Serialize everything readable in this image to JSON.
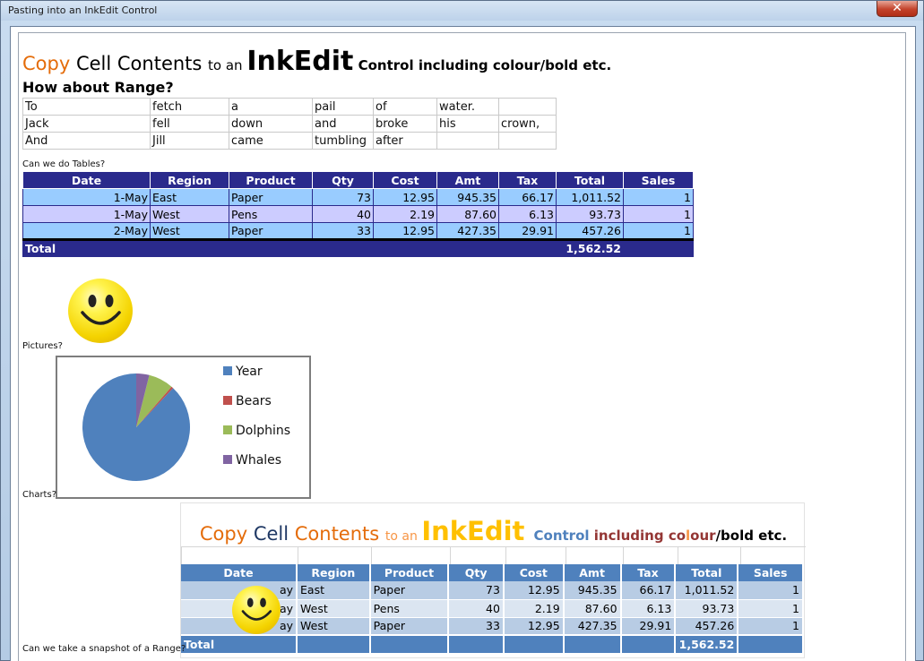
{
  "window": {
    "title": "Pasting into an InkEdit Control",
    "close_label": "✕"
  },
  "heading": {
    "copy": "Copy",
    "cell_contents": " Cell Contents ",
    "to_an": "to an ",
    "inkedit": "InkEdit",
    "rest": " Control including colour/bold etc."
  },
  "subheading": "How about Range?",
  "words_grid": [
    [
      "To",
      "fetch",
      "a",
      "pail",
      "of",
      "water.",
      ""
    ],
    [
      "Jack",
      "fell",
      "down",
      "and",
      "broke",
      "his",
      "crown,"
    ],
    [
      "And",
      "Jill",
      "came",
      "tumbling",
      "after",
      "",
      ""
    ]
  ],
  "labels": {
    "tables": "Can we do Tables?",
    "pictures": "Pictures?",
    "charts": "Charts?",
    "snapshot": "Can we take a snapshot of a Range?"
  },
  "data_table": {
    "headers": [
      "Date",
      "Region",
      "Product",
      "Qty",
      "Cost",
      "Amt",
      "Tax",
      "Total",
      "Sales"
    ],
    "rows": [
      [
        "1-May",
        "East",
        "Paper",
        "73",
        "12.95",
        "945.35",
        "66.17",
        "1,011.52",
        "1"
      ],
      [
        "1-May",
        "West",
        "Pens",
        "40",
        "2.19",
        "87.60",
        "6.13",
        "93.73",
        "1"
      ],
      [
        "2-May",
        "West",
        "Paper",
        "33",
        "12.95",
        "427.35",
        "29.91",
        "457.26",
        "1"
      ]
    ],
    "total_label": "Total",
    "total_value": "1,562.52"
  },
  "pie_chart": {
    "legend": [
      {
        "name": "Year",
        "color": "#4f81bd"
      },
      {
        "name": "Bears",
        "color": "#c0504d"
      },
      {
        "name": "Dolphins",
        "color": "#9bbb59"
      },
      {
        "name": "Whales",
        "color": "#8064a2"
      }
    ],
    "values": [
      88,
      0.6,
      7.5,
      3.9
    ]
  },
  "snapshot": {
    "heading": {
      "copy": "Copy ",
      "cell": "Cell ",
      "contents": "Contents ",
      "to_an": "to an ",
      "inkedit": "InkEdit ",
      "control": "Control ",
      "including": "including ",
      "co": "co",
      "l": "l",
      "our": "our",
      "rest": "/bold etc."
    },
    "headers": [
      "Date",
      "Region",
      "Product",
      "Qty",
      "Cost",
      "Amt",
      "Tax",
      "Total",
      "Sales"
    ],
    "rows": [
      [
        "ay",
        "East",
        "Paper",
        "73",
        "12.95",
        "945.35",
        "66.17",
        "1,011.52",
        "1"
      ],
      [
        "ay",
        "West",
        "Pens",
        "40",
        "2.19",
        "87.60",
        "6.13",
        "93.73",
        "1"
      ],
      [
        "ay",
        "West",
        "Paper",
        "33",
        "12.95",
        "427.35",
        "29.91",
        "457.26",
        "1"
      ]
    ],
    "total_label": "Total",
    "total_value": "1,562.52"
  }
}
